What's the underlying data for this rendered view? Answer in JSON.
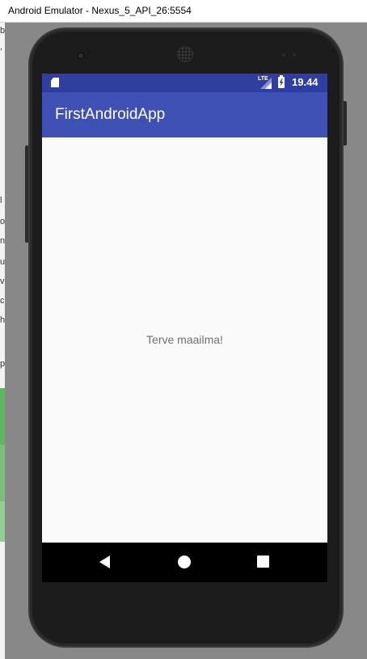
{
  "window": {
    "title": "Android Emulator - Nexus_5_API_26:5554"
  },
  "background_window": {
    "glyphs": [
      "b",
      ",",
      "l",
      "o",
      "n",
      "u",
      "v",
      "c",
      "h",
      "p"
    ]
  },
  "device": {
    "status_bar": {
      "network_label": "LTE",
      "time": "19.44",
      "color": "#303f9f",
      "icons": [
        "sd-card-icon",
        "signal-icon",
        "battery-charging-icon"
      ]
    },
    "app_bar": {
      "title": "FirstAndroidApp",
      "color": "#3f51b5"
    },
    "content": {
      "text": "Terve maailma!"
    },
    "nav_bar": {
      "icons": [
        "back-icon",
        "home-icon",
        "recents-icon"
      ]
    }
  }
}
